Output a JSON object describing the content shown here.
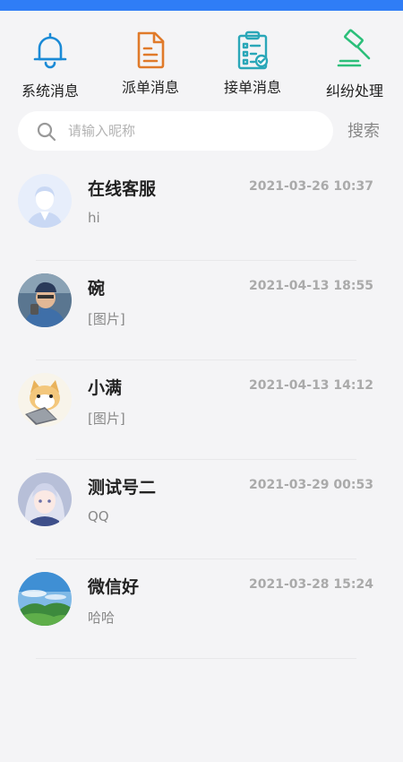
{
  "categories": [
    {
      "label": "系统消息",
      "icon": "bell-icon",
      "color": "#1a8ad6"
    },
    {
      "label": "派单消息",
      "icon": "document-icon",
      "color": "#e07a2a"
    },
    {
      "label": "接单消息",
      "icon": "clipboard-check-icon",
      "color": "#2aa7b8"
    },
    {
      "label": "纠纷处理",
      "icon": "gavel-icon",
      "color": "#2cbf7a"
    }
  ],
  "search": {
    "placeholder": "请输入昵称",
    "value": "",
    "button_label": "搜索"
  },
  "chats": [
    {
      "name": "在线客服",
      "time": "2021-03-26 10:37",
      "preview": "hi",
      "avatar": "customer-service-avatar"
    },
    {
      "name": "碗",
      "time": "2021-04-13 18:55",
      "preview": "[图片]",
      "avatar": "man-photo-avatar"
    },
    {
      "name": "小满",
      "time": "2021-04-13 14:12",
      "preview": "[图片]",
      "avatar": "cartoon-cat-avatar"
    },
    {
      "name": "测试号二",
      "time": "2021-03-29 00:53",
      "preview": "QQ",
      "avatar": "anime-girl-avatar"
    },
    {
      "name": "微信好",
      "time": "2021-03-28 15:24",
      "preview": "哈哈",
      "avatar": "landscape-avatar"
    }
  ]
}
